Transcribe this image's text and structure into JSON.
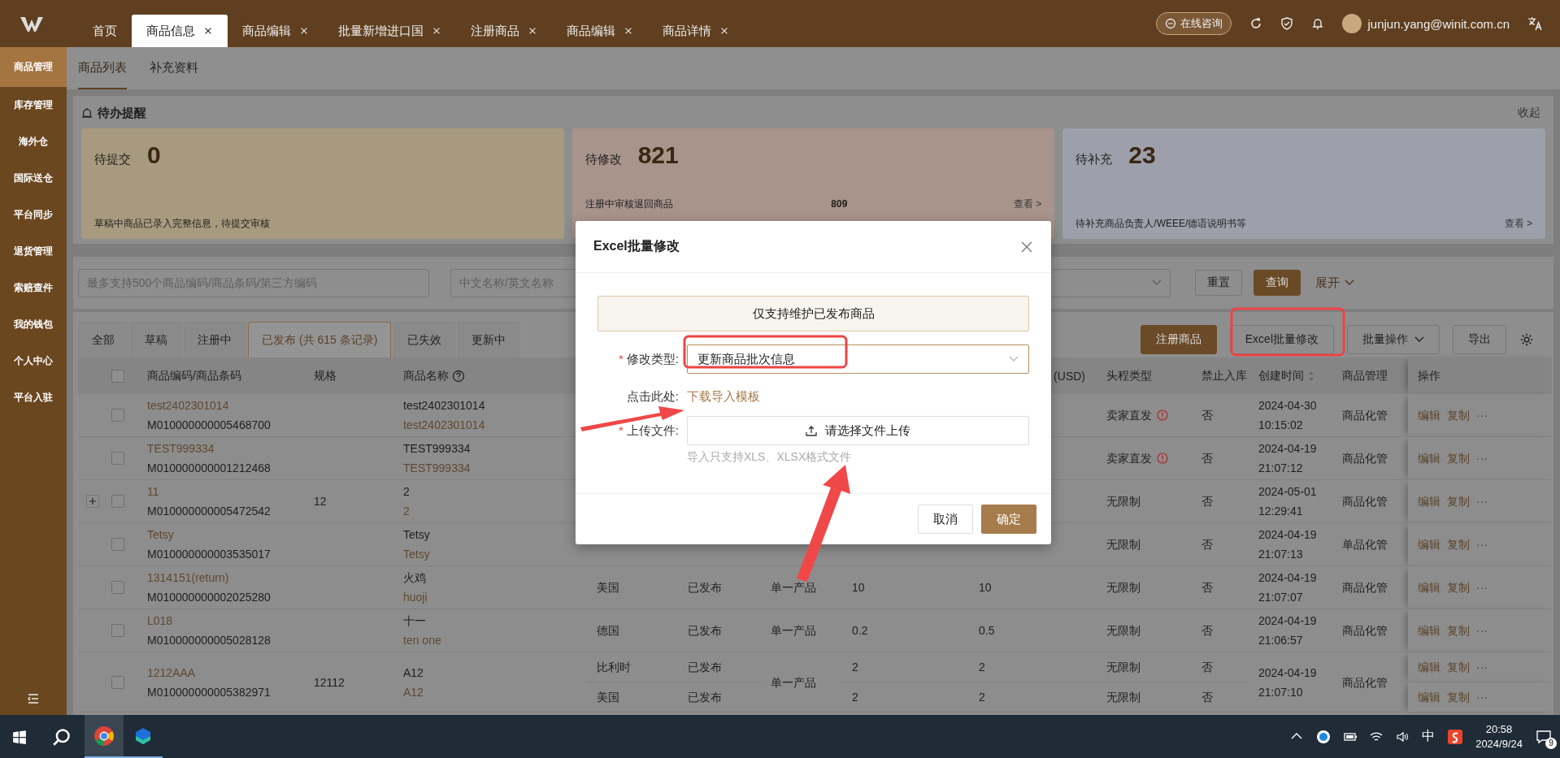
{
  "top_bar": {
    "tabs": [
      {
        "label": "首页",
        "closable": false,
        "selected": false
      },
      {
        "label": "商品信息",
        "closable": true,
        "selected": true
      },
      {
        "label": "商品编辑",
        "closable": true,
        "selected": false
      },
      {
        "label": "批量新增进口国",
        "closable": true,
        "selected": false
      },
      {
        "label": "注册商品",
        "closable": true,
        "selected": false
      },
      {
        "label": "商品编辑",
        "closable": true,
        "selected": false
      },
      {
        "label": "商品详情",
        "closable": true,
        "selected": false
      }
    ],
    "consult_button": "在线咨询",
    "user": "junjun.yang@winit.com.cn"
  },
  "sidebar": {
    "items": [
      {
        "label": "商品管理",
        "selected": true
      },
      {
        "label": "库存管理",
        "selected": false
      },
      {
        "label": "海外仓",
        "selected": false
      },
      {
        "label": "国际送仓",
        "selected": false
      },
      {
        "label": "平台同步",
        "selected": false
      },
      {
        "label": "退货管理",
        "selected": false
      },
      {
        "label": "索赔查件",
        "selected": false
      },
      {
        "label": "我的钱包",
        "selected": false
      },
      {
        "label": "个人中心",
        "selected": false
      },
      {
        "label": "平台入驻",
        "selected": false
      }
    ]
  },
  "sub_tabs": [
    {
      "label": "商品列表",
      "selected": true
    },
    {
      "label": "补充资料",
      "selected": false
    }
  ],
  "todo": {
    "title": "待办提醒",
    "collapse": "收起",
    "cards": [
      {
        "title": "待提交",
        "count": "0",
        "color": "#a89a7e",
        "lines": [
          {
            "text": "草稿中商品已录入完整信息，待提交审核"
          }
        ]
      },
      {
        "title": "待修改",
        "count": "821",
        "color": "#a8948b",
        "lines": [
          {
            "text": "注册中审核退回商品",
            "count": "809",
            "link": "查看 >"
          }
        ]
      },
      {
        "title": "待补充",
        "count": "23",
        "color": "#9d9faa",
        "lines": [
          {
            "text": "待补充商品负责人/WEEE/德语说明书等",
            "link": "查看 >"
          }
        ]
      }
    ]
  },
  "filters": {
    "code_placeholder": "最多支持500个商品编码/商品条码/第三方编码",
    "name_placeholder": "中文名称/英文名称",
    "reset": "重置",
    "search": "查询",
    "expand": "展开"
  },
  "status_tabs": [
    {
      "label": "全部",
      "selected": false
    },
    {
      "label": "草稿",
      "selected": false
    },
    {
      "label": "注册中",
      "selected": false
    },
    {
      "label": "已发布 (共 615 条记录)",
      "selected": true
    },
    {
      "label": "已失效",
      "selected": false
    },
    {
      "label": "更新中",
      "selected": false
    }
  ],
  "toolbar": [
    {
      "label": "注册商品",
      "kind": "primary"
    },
    {
      "label": "Excel批量修改",
      "kind": "default"
    },
    {
      "label": "批量操作",
      "kind": "dropdown"
    },
    {
      "label": "导出",
      "kind": "default"
    }
  ],
  "table": {
    "header_checked": false,
    "columns": {
      "code": "商品编码/商品条码",
      "spec": "规格",
      "name": "商品名称",
      "value_usd": "(USD)",
      "route": "头程类型",
      "banned": "禁止入库",
      "created": "创建时间",
      "management": "商品管理",
      "actions": "操作"
    },
    "rows": [
      {
        "code": "test2402301014",
        "barcode": "M010000000005468700",
        "name": "test2402301014",
        "name_en": "test2402301014",
        "expandable": false,
        "checked": false,
        "created_date": "2024-04-30",
        "created_time": "10:15:02",
        "management": "商品化管",
        "lines": [
          {
            "route": "卖家直发",
            "route_warning": true,
            "banned": "否",
            "actions": [
              "编辑",
              "复制",
              "···"
            ]
          }
        ]
      },
      {
        "code": "TEST999334",
        "barcode": "M010000000001212468",
        "name": "TEST999334",
        "name_en": "TEST999334",
        "expandable": false,
        "checked": false,
        "created_date": "2024-04-19",
        "created_time": "21:07:12",
        "management": "商品化管",
        "lines": [
          {
            "route": "卖家直发",
            "route_warning": true,
            "banned": "否",
            "actions": [
              "编辑",
              "复制",
              "···"
            ]
          }
        ]
      },
      {
        "code": "11",
        "barcode": "M010000000005472542",
        "spec": "12",
        "name": "2",
        "name_en": "2",
        "expandable": true,
        "checked": false,
        "created_date": "2024-05-01",
        "created_time": "12:29:41",
        "management": "商品化管",
        "lines": [
          {
            "route": "无限制",
            "route_warning": false,
            "banned": "否",
            "actions": [
              "编辑",
              "复制",
              "···"
            ]
          }
        ]
      },
      {
        "code": "Tetsy",
        "barcode": "M010000000003535017",
        "name": "Tetsy",
        "name_en": "Tetsy",
        "expandable": false,
        "checked": false,
        "created_date": "2024-04-19",
        "created_time": "21:07:13",
        "management": "单品化管",
        "lines": [
          {
            "route": "无限制",
            "route_warning": false,
            "banned": "否",
            "actions": [
              "编辑",
              "复制",
              "···"
            ]
          }
        ]
      },
      {
        "code": "1314151(return)",
        "barcode": "M010000000002025280",
        "name": "火鸡",
        "name_en": "huoji",
        "type": "单一产品",
        "expandable": false,
        "checked": false,
        "created_date": "2024-04-19",
        "created_time": "21:07:07",
        "management": "商品化管",
        "lines": [
          {
            "country": "美国",
            "status": "已发布",
            "value_1": "10",
            "value_2": "10",
            "route": "无限制",
            "route_warning": false,
            "banned": "否",
            "actions": [
              "编辑",
              "复制",
              "···"
            ]
          }
        ]
      },
      {
        "code": "L018",
        "barcode": "M010000000005028128",
        "name": "十一",
        "name_en": "ten one",
        "type": "单一产品",
        "expandable": false,
        "checked": false,
        "created_date": "2024-04-19",
        "created_time": "21:06:57",
        "management": "商品化管",
        "lines": [
          {
            "country": "德国",
            "status": "已发布",
            "value_1": "0.2",
            "value_2": "0.5",
            "route": "无限制",
            "route_warning": false,
            "banned": "否",
            "actions": [
              "编辑",
              "复制",
              "···"
            ]
          }
        ]
      },
      {
        "code": "1212AAA",
        "barcode": "M010000000005382971",
        "spec": "12112",
        "name": "A12",
        "name_en": "A12",
        "type": "单一产品",
        "expandable": false,
        "checked": false,
        "created_date": "2024-04-19",
        "created_time": "21:07:10",
        "management": "商品化管",
        "lines": [
          {
            "country": "比利时",
            "status": "已发布",
            "value_1": "2",
            "value_2": "2",
            "route": "无限制",
            "route_warning": false,
            "banned": "否",
            "actions": [
              "编辑",
              "复制",
              "···"
            ]
          },
          {
            "country": "美国",
            "status": "已发布",
            "value_1": "2",
            "value_2": "2",
            "route": "无限制",
            "route_warning": false,
            "banned": "否",
            "actions": [
              "编辑",
              "复制",
              "···"
            ]
          }
        ]
      }
    ]
  },
  "modal": {
    "title": "Excel批量修改",
    "notice": "仅支持维护已发布商品",
    "fields": [
      {
        "kind": "select",
        "label": "修改类型:",
        "required_mark": "*",
        "value": "更新商品批次信息"
      },
      {
        "kind": "link",
        "label": "点击此处:",
        "link": "下载导入模板"
      },
      {
        "kind": "upload",
        "label": "上传文件:",
        "required_mark": "*",
        "button": "请选择文件上传",
        "hint": "导入只支持XLS、XLSX格式文件"
      }
    ],
    "buttons": [
      {
        "label": "取消",
        "kind": "default"
      },
      {
        "label": "确定",
        "kind": "primary"
      }
    ]
  },
  "taskbar": {
    "apps": [
      {
        "kind": "browser",
        "selected": true
      },
      {
        "kind": "mail",
        "selected": false
      }
    ],
    "ime": "中",
    "time": "20:58",
    "date": "2024/9/24",
    "notifications": "9"
  }
}
